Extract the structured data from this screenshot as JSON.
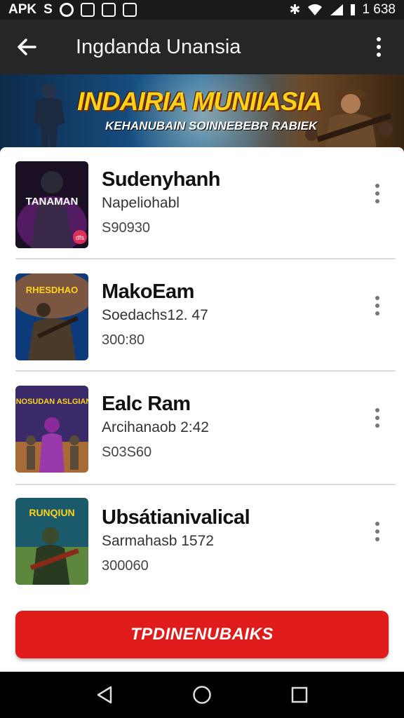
{
  "status_bar": {
    "carrier": "APK",
    "letter": "S",
    "time": "1 638"
  },
  "app_bar": {
    "title": "Ingdanda Unansia"
  },
  "banner": {
    "title": "INDAIRIA MUNIIASIA",
    "subtitle": "KEHANUBAIN SOINNEBEBR RABIEK"
  },
  "items": [
    {
      "title": "Sudenyhanh",
      "subtitle": "Napeliohabl",
      "price": "S90930",
      "thumb_text": "TANAMAN",
      "thumb_badge": "dfs",
      "thumb_colors": [
        "#1b0f24",
        "#6a1f7a"
      ]
    },
    {
      "title": "MakoEam",
      "subtitle": "Soedachs12. 47",
      "price": "300:80",
      "thumb_text": "RHESDHAO",
      "thumb_colors": [
        "#0d3a7a",
        "#c46a1a"
      ]
    },
    {
      "title": "Ealc Ram",
      "subtitle": "Arcihanaob 2:42",
      "price": "S03S60",
      "thumb_text": "RNOSUDAN ASLGIANI",
      "thumb_colors": [
        "#3a2a6a",
        "#c47a2a"
      ]
    },
    {
      "title": "Ubsátianivalical",
      "subtitle": "Sarmahasb 1572",
      "price": "300060",
      "thumb_text": "RUNQIUN",
      "thumb_colors": [
        "#1a5a6a",
        "#7a9a2a"
      ]
    }
  ],
  "action": {
    "label": "TPDINENUBAIKS"
  },
  "colors": {
    "accent": "#e01b1b",
    "app_bar": "#262626",
    "banner_title": "#ffd21a"
  }
}
